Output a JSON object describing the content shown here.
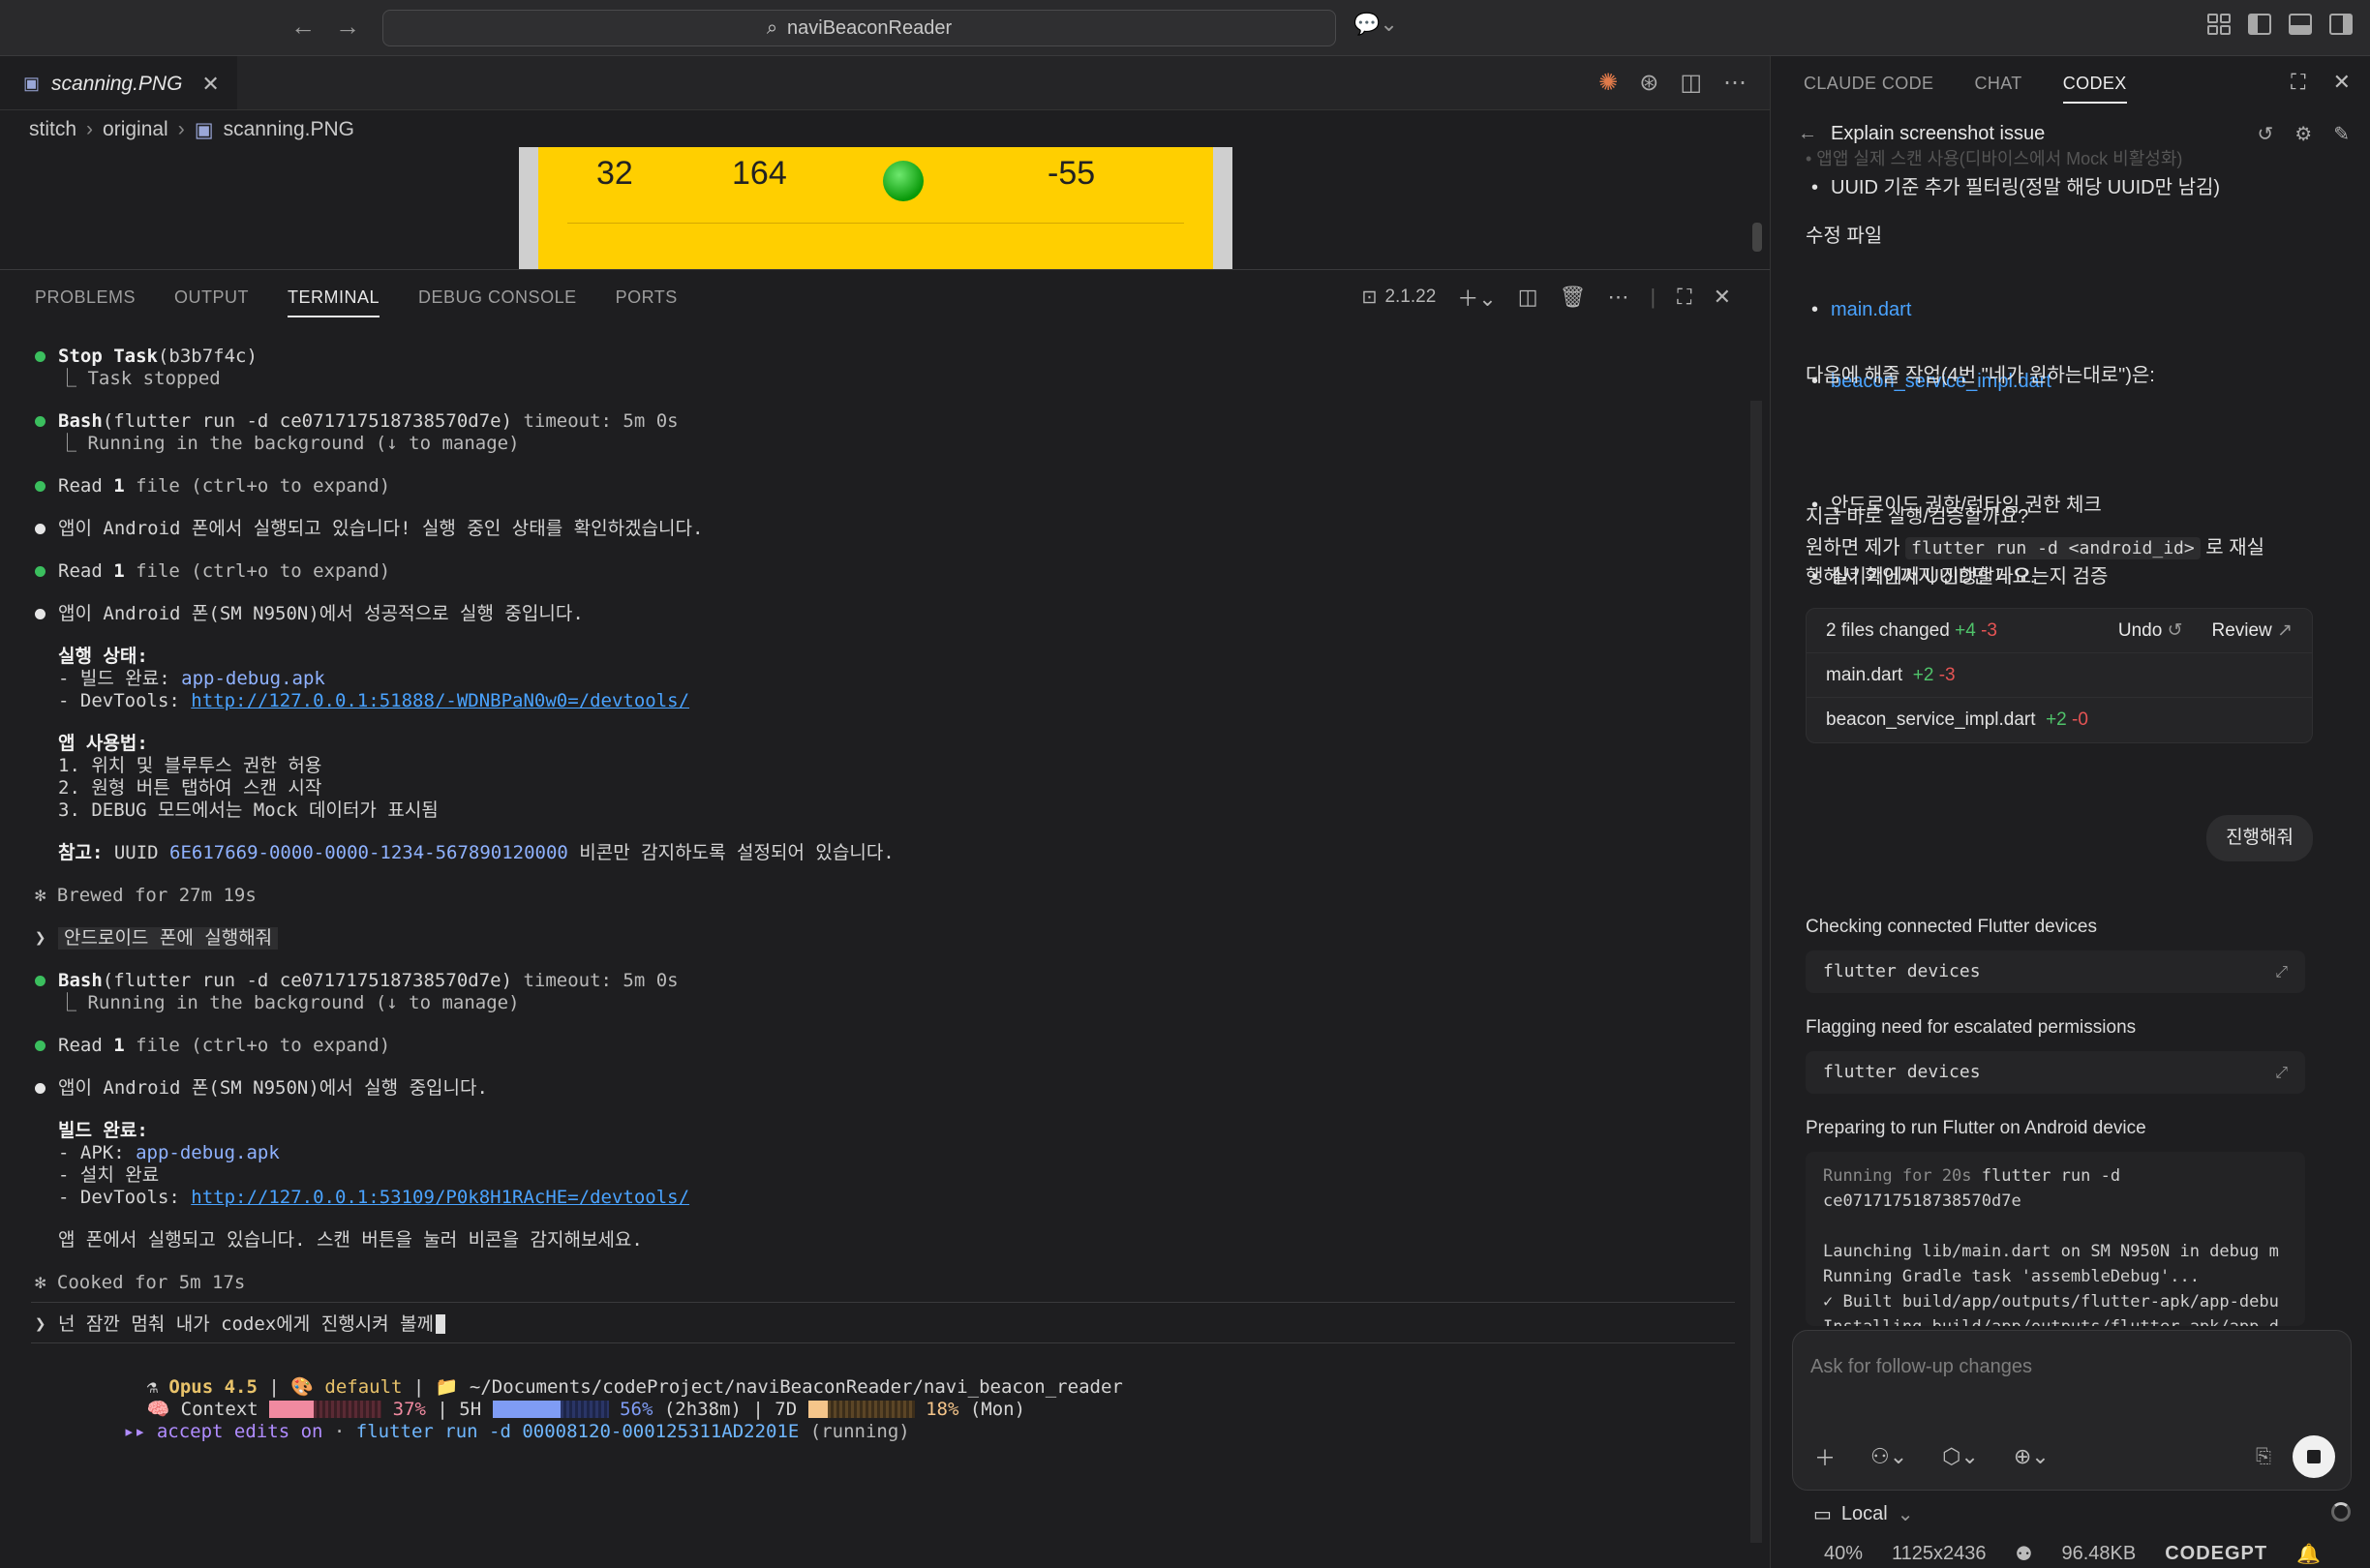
{
  "window": {
    "search_text": "naviBeaconReader"
  },
  "editor": {
    "tab": {
      "label": "scanning.PNG"
    },
    "breadcrumb": [
      "stitch",
      "original",
      "scanning.PNG"
    ],
    "preview": {
      "values": [
        "32",
        "164",
        "-55"
      ]
    }
  },
  "panel": {
    "tabs": [
      "PROBLEMS",
      "OUTPUT",
      "TERMINAL",
      "DEBUG CONSOLE",
      "PORTS"
    ],
    "active_tab": "TERMINAL",
    "terminal_version": "2.1.22"
  },
  "terminal": {
    "l1a": "Stop Task",
    "l1b": "(b3b7f4c)",
    "l1c": "⎿ Task stopped",
    "l2a": "Bash",
    "l2b": "(flutter run -d ce071717518738570d7e)",
    "l2c": " timeout: 5m 0s",
    "l2d": "⎿ Running in the background (↓ to manage)",
    "l3a": "Read ",
    "l3b": "1",
    "l3c": " file (ctrl+o to expand)",
    "l4": "앱이 Android 폰에서 실행되고 있습니다! 실행 중인 상태를 확인하겠습니다.",
    "l5a": "Read ",
    "l5b": "1",
    "l5c": " file (ctrl+o to expand)",
    "l6": "앱이 Android 폰(SM N950N)에서 성공적으로 실행 중입니다.",
    "l7": "실행 상태:",
    "l8a": "- 빌드 완료: ",
    "l8b": "app-debug.apk",
    "l9a": "- DevTools: ",
    "l9b": "http://127.0.0.1:51888/-WDNBPaN0w0=/devtools/",
    "l10": "앱 사용법:",
    "l11": "1. 위치 및 블루투스 권한 허용",
    "l12": "2. 원형 버튼 탭하여 스캔 시작",
    "l13": "3. DEBUG 모드에서는 Mock 데이터가 표시됨",
    "l14a": "참고: ",
    "l14b": "UUID ",
    "l14c": "6E617669-0000-0000-1234-567890120000",
    "l14d": " 비콘만 감지하도록 설정되어 있습니다.",
    "l15": "✻ Brewed for 27m 19s",
    "l16": "안드로이드 폰에 실행해줘",
    "l17a": "Bash",
    "l17b": "(flutter run -d ce071717518738570d7e)",
    "l17c": " timeout: 5m 0s",
    "l17d": "⎿ Running in the background (↓ to manage)",
    "l18a": "Read ",
    "l18b": "1",
    "l18c": " file (ctrl+o to expand)",
    "l19": "앱이 Android 폰(SM N950N)에서 실행 중입니다.",
    "l20": "빌드 완료:",
    "l21a": "- APK: ",
    "l21b": "app-debug.apk",
    "l22": "- 설치 완료",
    "l23a": "- DevTools: ",
    "l23b": "http://127.0.0.1:53109/P0k8H1RAcHE=/devtools/",
    "l24": "앱 폰에서 실행되고 있습니다. 스캔 버튼을 눌러 비콘을 감지해보세요.",
    "l25": "✻ Cooked for 5m 17s",
    "l26": "넌 잠깐 멈춰 내가 codex에게 진행시켜 볼께",
    "s1a": "Opus 4.5",
    "s1b": "default",
    "s1c": "~/Documents/codeProject/naviBeaconReader/navi_beacon_reader",
    "s2a": "Context",
    "s2b": "37%",
    "s2c": "5H",
    "s2d": "56%",
    "s2e": "(2h38m)",
    "s2f": "7D",
    "s2g": "18%",
    "s2h": "(Mon)",
    "s3a": "accept edits on",
    "s3b": " · ",
    "s3c": "flutter run -d 00008120-000125311AD2201E",
    "s3d": " (running)"
  },
  "right": {
    "tabs": [
      "CLAUDE CODE",
      "CHAT",
      "CODEX"
    ],
    "active_tab": "CODEX",
    "header": "Explain screenshot issue",
    "faded": "• 앱앱 실제 스캔 사용(디바이스에서 Mock 비활성화)",
    "b1": "UUID 기준 추가 필터링(정말 해당 UUID만 남김)",
    "h1": "수정 파일",
    "f1": "main.dart",
    "f2": "beacon_service_impl.dart",
    "p1": "다음에 해줄 작업(4번 \"네가 원하는대로\")은:",
    "b2": "안드로이드 권한/런타임 권한 체크",
    "b3": "실기기에서 UUID만 나오는지 검증",
    "p2": "지금 바로 실행/검증할까요?",
    "p3a": "원하면 제가 ",
    "p3b": "flutter run -d <android_id>",
    "p3c": " 로 재실",
    "p3d": "행해서 확인까지 진행할게요.",
    "changes": {
      "label": "2 files changed",
      "add": "+4",
      "del": "-3",
      "undo": "Undo",
      "review": "Review",
      "files": [
        {
          "name": "main.dart",
          "add": "+2",
          "del": "-3"
        },
        {
          "name": "beacon_service_impl.dart",
          "add": "+2",
          "del": "-0"
        }
      ]
    },
    "bubble": "진행해줘",
    "step1": "Checking connected Flutter devices",
    "cmd1": "flutter devices",
    "step2": "Flagging need for escalated permissions",
    "cmd2": "flutter devices",
    "step3": "Preparing to run Flutter on Android device",
    "out1a": "Running for 20s",
    "out1b": " flutter run -d",
    "out2": "ce071717518738570d7e",
    "out3": "Launching lib/main.dart on SM N950N in debug m",
    "out4": "Running Gradle task 'assembleDebug'...",
    "out5": "✓ Built build/app/outputs/flutter-apk/app-debu",
    "out6": "Installing build/app/outputs/flutter-apk/app-d",
    "composer_placeholder": "Ask for follow-up changes",
    "local": "Local"
  },
  "statusbar": {
    "zoom": "40%",
    "dims": "1125x2436",
    "size": "96.48KB",
    "brand": "CODEGPT"
  }
}
